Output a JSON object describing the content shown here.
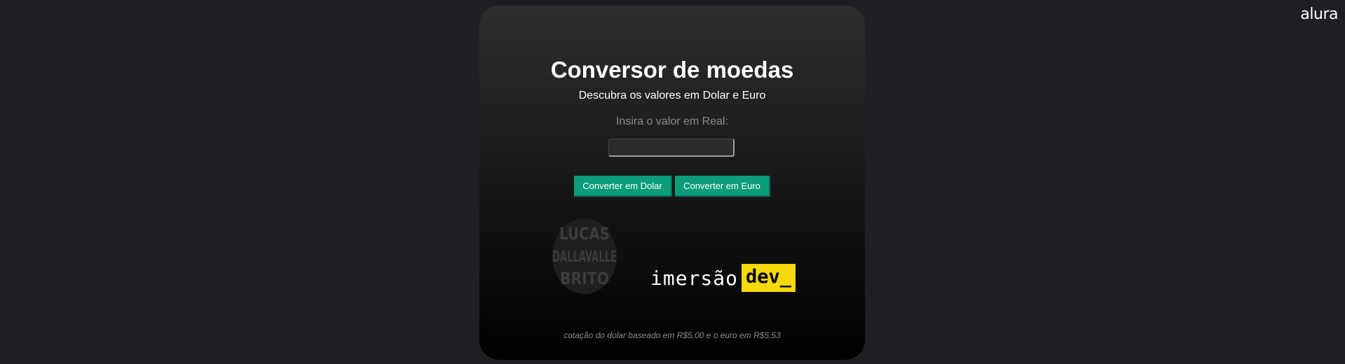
{
  "brand": {
    "name": "alura"
  },
  "card": {
    "title": "Conversor de moedas",
    "subtitle": "Descubra os valores em Dolar e Euro",
    "input_label": "Insira o valor em Real:",
    "input_value": "",
    "buttons": {
      "dolar": "Converter em Dolar",
      "euro": "Converter em Euro"
    },
    "logos": {
      "lucas_lines": [
        "LUCAS",
        "DALLAVALLE",
        "BRITO"
      ],
      "imersao_word": "imersão",
      "imersao_dev": "dev_"
    },
    "footnote": "cotação do dolar baseado em R$5,00 e o euro em R$5,53"
  },
  "colors": {
    "page_bg": "#1e1f24",
    "button_accent": "#0d9c79",
    "dev_badge": "#f5d90a"
  }
}
